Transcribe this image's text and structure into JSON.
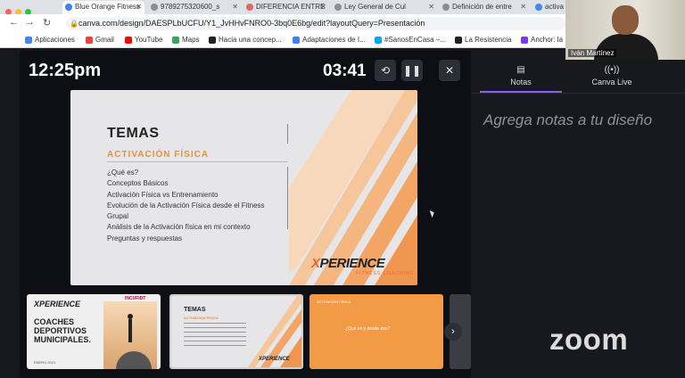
{
  "browser": {
    "tabs": [
      {
        "label": "Blue Orange Fitness",
        "active": true
      },
      {
        "label": "9789275320600_s",
        "active": false
      },
      {
        "label": "DIFERENCIA ENTRE",
        "active": false
      },
      {
        "label": "Ley General de Cul",
        "active": false
      },
      {
        "label": "Definición de entre",
        "active": false
      },
      {
        "label": "activa",
        "active": false
      }
    ],
    "url": "canva.com/design/DAESPLbUCFU/Y1_JvHHvFNRO0-3bq0E6bg/edit?layoutQuery=Presentación",
    "bookmarks": [
      {
        "label": "Aplicaciones",
        "color": "#4285f4"
      },
      {
        "label": "Gmail",
        "color": "#ea4335"
      },
      {
        "label": "YouTube",
        "color": "#ff0000"
      },
      {
        "label": "Maps",
        "color": "#34a853"
      },
      {
        "label": "Hacia una concep...",
        "color": "#222222"
      },
      {
        "label": "Adaptaciones de I...",
        "color": "#3b82f6"
      },
      {
        "label": "#SanosEnCasa –...",
        "color": "#0ea5e9"
      },
      {
        "label": "La Resistencia",
        "color": "#222222"
      },
      {
        "label": "Anchor: la",
        "color": "#7c3aed"
      }
    ]
  },
  "presenter": {
    "clock": "12:25pm",
    "timer": "03:41"
  },
  "slide": {
    "title": "TEMAS",
    "subtitle": "ACTIVACIÓN FÍSICA",
    "items": [
      "¿Qué es?",
      "Conceptos Básicos",
      "Activación Física vs Entrenamiento",
      "Evolución de la Activación Física desde el Fitness Grupal",
      "Análisis de la Activación física en mi contexto",
      "Preguntas y respuestas"
    ],
    "logo_x": "X",
    "logo_text": "PERIENCE",
    "logo_sub": "FITNESS COACHING"
  },
  "thumbnails": {
    "t1": {
      "logo": "XPERIENCE",
      "title": "COACHES DEPORTIVOS MUNICIPALES.",
      "badge": "INCUFIDT",
      "date": "ENERO 2021"
    },
    "t2": {
      "title": "TEMAS",
      "subtitle": "ACTIVACIÓN FÍSICA",
      "logo": "XPERIENCE"
    },
    "t3": {
      "title": "ACTIVACIÓN FÍSICA",
      "body": "¿Qué es y desde eso?"
    }
  },
  "notes": {
    "tab_notes": "Notas",
    "tab_live": "Canva Live",
    "placeholder": "Agrega notas a tu diseño",
    "zoom_brand": "zoom"
  },
  "webcam": {
    "name": "Iván Martínez"
  },
  "colors": {
    "accent": "#e8903a",
    "brand_orange": "#e8672a",
    "tab_underline": "#8b5cf6"
  }
}
